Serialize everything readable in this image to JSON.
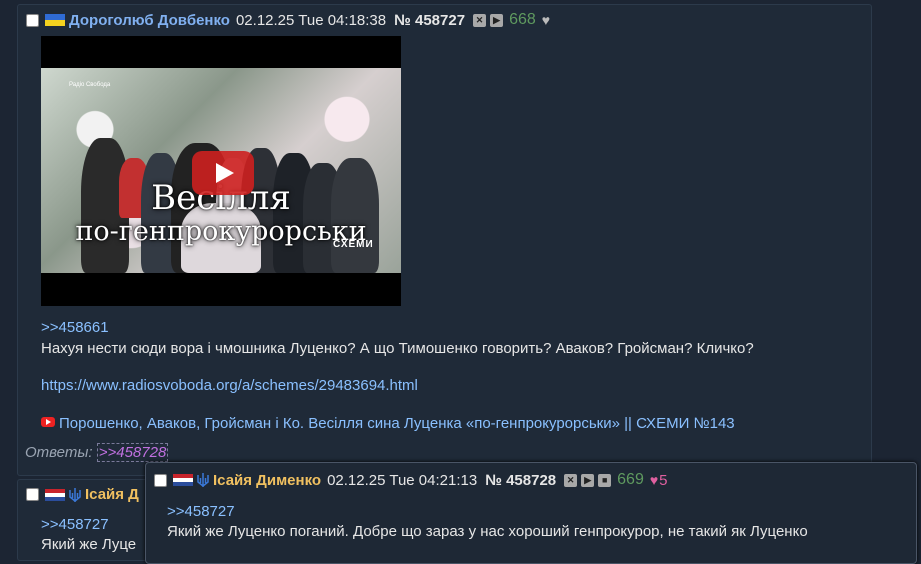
{
  "post": {
    "author": "Дороголюб Довбенко",
    "date": "02.12.25 Tue 04:18:38",
    "number": "№ 458727",
    "count": "668",
    "reply_ref": ">>458661",
    "text": "Нахуя нести сюди вора і чмошника Луценко? А що Тимошенко говорить? Аваков? Гройсман? Кличко?",
    "url": "https://www.radiosvoboda.org/a/schemes/29483694.html",
    "video_title": "Порошенко, Аваков, Гройсман і Ко. Весілля сина Луценка «по-генпрокурорськи» || СХЕМИ №143",
    "video": {
      "caption_line1": "Весілля",
      "caption_line2": "по-генпрокурорськи",
      "logo_left": "Радіо Свобода",
      "logo_right": "СХЕМИ"
    },
    "replies_label": "Ответы:",
    "replies_link": ">>458728"
  },
  "post2": {
    "author": "Ісайя Д",
    "reply_ref": ">>458727",
    "text": "Який же Луце"
  },
  "preview": {
    "author": "Ісайя Дименко",
    "date": "02.12.25 Tue 04:21:13",
    "number": "№ 458728",
    "count": "669",
    "likes": "5",
    "reply_ref": ">>458727",
    "text": "Який же Луценко поганий. Добре що зараз у нас хороший генпрокурор, не такий як Луценко"
  },
  "colors": {
    "background": "#1c2533",
    "post_bg": "#1f2a38",
    "name_blue": "#80b0f0",
    "name_gold": "#f0c060",
    "link": "#8ac0ff",
    "count_green": "#5f9a5f",
    "heart_pink": "#e060a0"
  },
  "icons": [
    "checkbox",
    "flag-ukraine",
    "flag-netherlands",
    "trident-icon",
    "hide-icon",
    "play-icon",
    "stop-icon",
    "heart-icon",
    "youtube-icon",
    "video-play-icon"
  ]
}
